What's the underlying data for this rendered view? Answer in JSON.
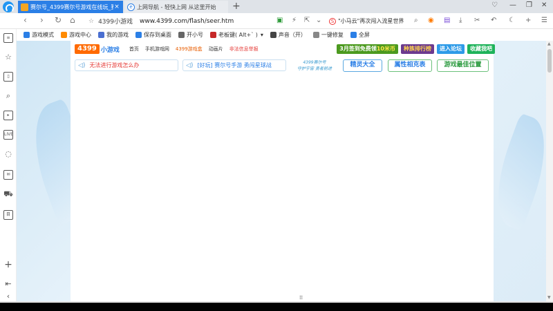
{
  "tabs": [
    {
      "title": "赛尔号_4399赛尔号游戏在线玩_赛尔",
      "close": "×",
      "active": true
    },
    {
      "title": "上网导航 - 轻快上网 从这里开始",
      "close": "",
      "active": false
    }
  ],
  "new_tab": "+",
  "address": {
    "site_label": "4399小游戏",
    "url": "www.4399.com/flash/seer.htm"
  },
  "news_ticker": "\"小马云\"再次闯入流星世界",
  "bookmarks": [
    {
      "label": "游戏模式",
      "color": "#2b7fe6"
    },
    {
      "label": "游戏中心",
      "color": "#ff8a00"
    },
    {
      "label": "我的游戏",
      "color": "#4a6fd1"
    },
    {
      "label": "保存到桌面",
      "color": "#2b7fe6"
    },
    {
      "label": "开小号",
      "color": "#666666"
    },
    {
      "label": "老板键( Alt+` )",
      "color": "#c62828"
    },
    {
      "label": "声音（开）",
      "color": "#444444"
    },
    {
      "label": "一键修复",
      "color": "#888888"
    },
    {
      "label": "全屏",
      "color": "#2b7fe6"
    }
  ],
  "site": {
    "brand": "4399",
    "brand_sub": "小游戏",
    "nav": [
      "首页",
      "手机游戏网",
      "4399游戏盒",
      "动画片",
      "非法信息举报"
    ],
    "promo_signin": "3月签到免费领",
    "promo_signin_highlight": "10米币",
    "promo_rank": "种族排行榜",
    "promo_forum": "进入论坛",
    "promo_collect": "收藏我吧"
  },
  "notice1": "无法进行游戏怎么办",
  "notice2": "[好玩] 赛尔号手游 勇闯星球战",
  "script_text": [
    "4399赛尔号",
    "守护宇宙 勇者前进"
  ],
  "game_buttons": [
    "精灵大全",
    "属性相克表",
    "游戏最佳位置"
  ],
  "bottom_mark": "⁞⁞"
}
